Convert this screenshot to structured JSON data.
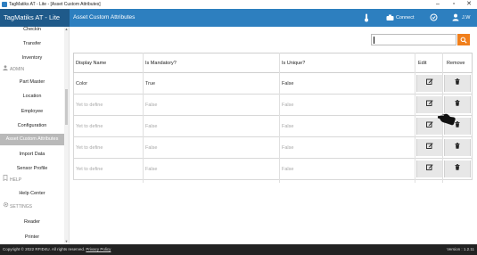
{
  "titlebar": {
    "text": "TagMatiks AT - Lite - [Asset Custom Attributes]",
    "minimize": "–",
    "maximize": "▫",
    "close": "✕"
  },
  "header": {
    "brand": "TagMatiks AT - Lite",
    "title": "Asset Custom Attributes",
    "connect_label": "Connect",
    "user_label": "J.W"
  },
  "sidebar": {
    "items": {
      "checkin": "Checkin",
      "transfer": "Transfer",
      "inventory": "Inventory",
      "admin": "ADMIN",
      "part_master": "Part Master",
      "location": "Location",
      "employee": "Employee",
      "configuration": "Configuration",
      "asset_custom_attributes": "Asset Custom Attributes",
      "import_data": "Import Data",
      "sensor_profile": "Sensor Profile",
      "help": "HELP",
      "help_center": "Help Center",
      "settings": "SETTINGS",
      "reader": "Reader",
      "printer": "Printer"
    }
  },
  "search": {
    "value": "",
    "button_icon": "search-icon"
  },
  "table": {
    "headers": [
      "Display Name",
      "Is Mandatory?",
      "Is Unique?",
      "Edit",
      "Remove"
    ],
    "rows": [
      {
        "name": "Color",
        "mandatory": "True",
        "unique": "False"
      },
      {
        "name": "Yet to define",
        "mandatory": "False",
        "unique": "False"
      },
      {
        "name": "Yet to define",
        "mandatory": "False",
        "unique": "False"
      },
      {
        "name": "Yet to define",
        "mandatory": "False",
        "unique": "False"
      },
      {
        "name": "Yet to define",
        "mandatory": "False",
        "unique": "False"
      }
    ]
  },
  "footer": {
    "copyright": "Copyright © 2022 RFID4U. All rights reserved.",
    "privacy": "Privacy Policy",
    "version": "Version : 1.2.11"
  },
  "colors": {
    "header": "#2d7fbf",
    "brand": "#1f5a8a",
    "accent": "#f07f1c",
    "active_nav": "#b9b9b9",
    "footer": "#222222"
  }
}
